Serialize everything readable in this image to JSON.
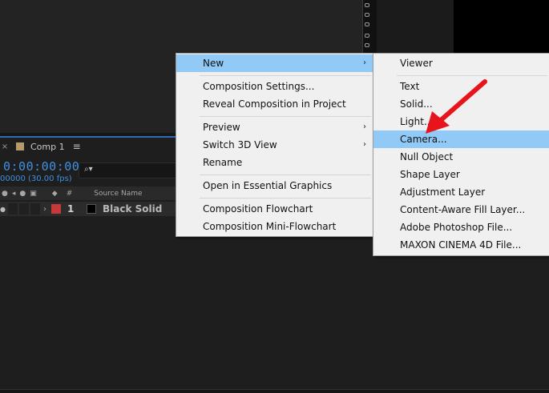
{
  "composition_tab": {
    "close_glyph": "×",
    "name": "Comp 1",
    "menu_glyph": "≡"
  },
  "timeline": {
    "timecode": "0:00:00:00",
    "fps": "00000 (30.00 fps)",
    "search_glyph": "⌕▾",
    "source_name_header": "Source Name",
    "hash_header": "#"
  },
  "layer": {
    "number": "1",
    "name": "Black Solid",
    "label_color": "#c43a3a"
  },
  "main_menu": {
    "items": [
      {
        "label": "New",
        "submenu": true,
        "highlighted": true
      },
      {
        "label": "Composition Settings..."
      },
      {
        "label": "Reveal Composition in Project"
      },
      {
        "label": "Preview",
        "submenu": true
      },
      {
        "label": "Switch 3D View",
        "submenu": true
      },
      {
        "label": "Rename"
      },
      {
        "label": "Open in Essential Graphics"
      },
      {
        "label": "Composition Flowchart"
      },
      {
        "label": "Composition Mini-Flowchart"
      }
    ]
  },
  "sub_menu": {
    "items": [
      {
        "label": "Viewer"
      },
      {
        "label": "Text"
      },
      {
        "label": "Solid..."
      },
      {
        "label": "Light..."
      },
      {
        "label": "Camera...",
        "highlighted": true
      },
      {
        "label": "Null Object"
      },
      {
        "label": "Shape Layer"
      },
      {
        "label": "Adjustment Layer"
      },
      {
        "label": "Content-Aware Fill Layer..."
      },
      {
        "label": "Adobe Photoshop File..."
      },
      {
        "label": "MAXON CINEMA 4D File..."
      }
    ]
  },
  "colors": {
    "highlight": "#91c9f7",
    "timecode": "#3f8fe2",
    "annotation_arrow": "#e8141c"
  }
}
